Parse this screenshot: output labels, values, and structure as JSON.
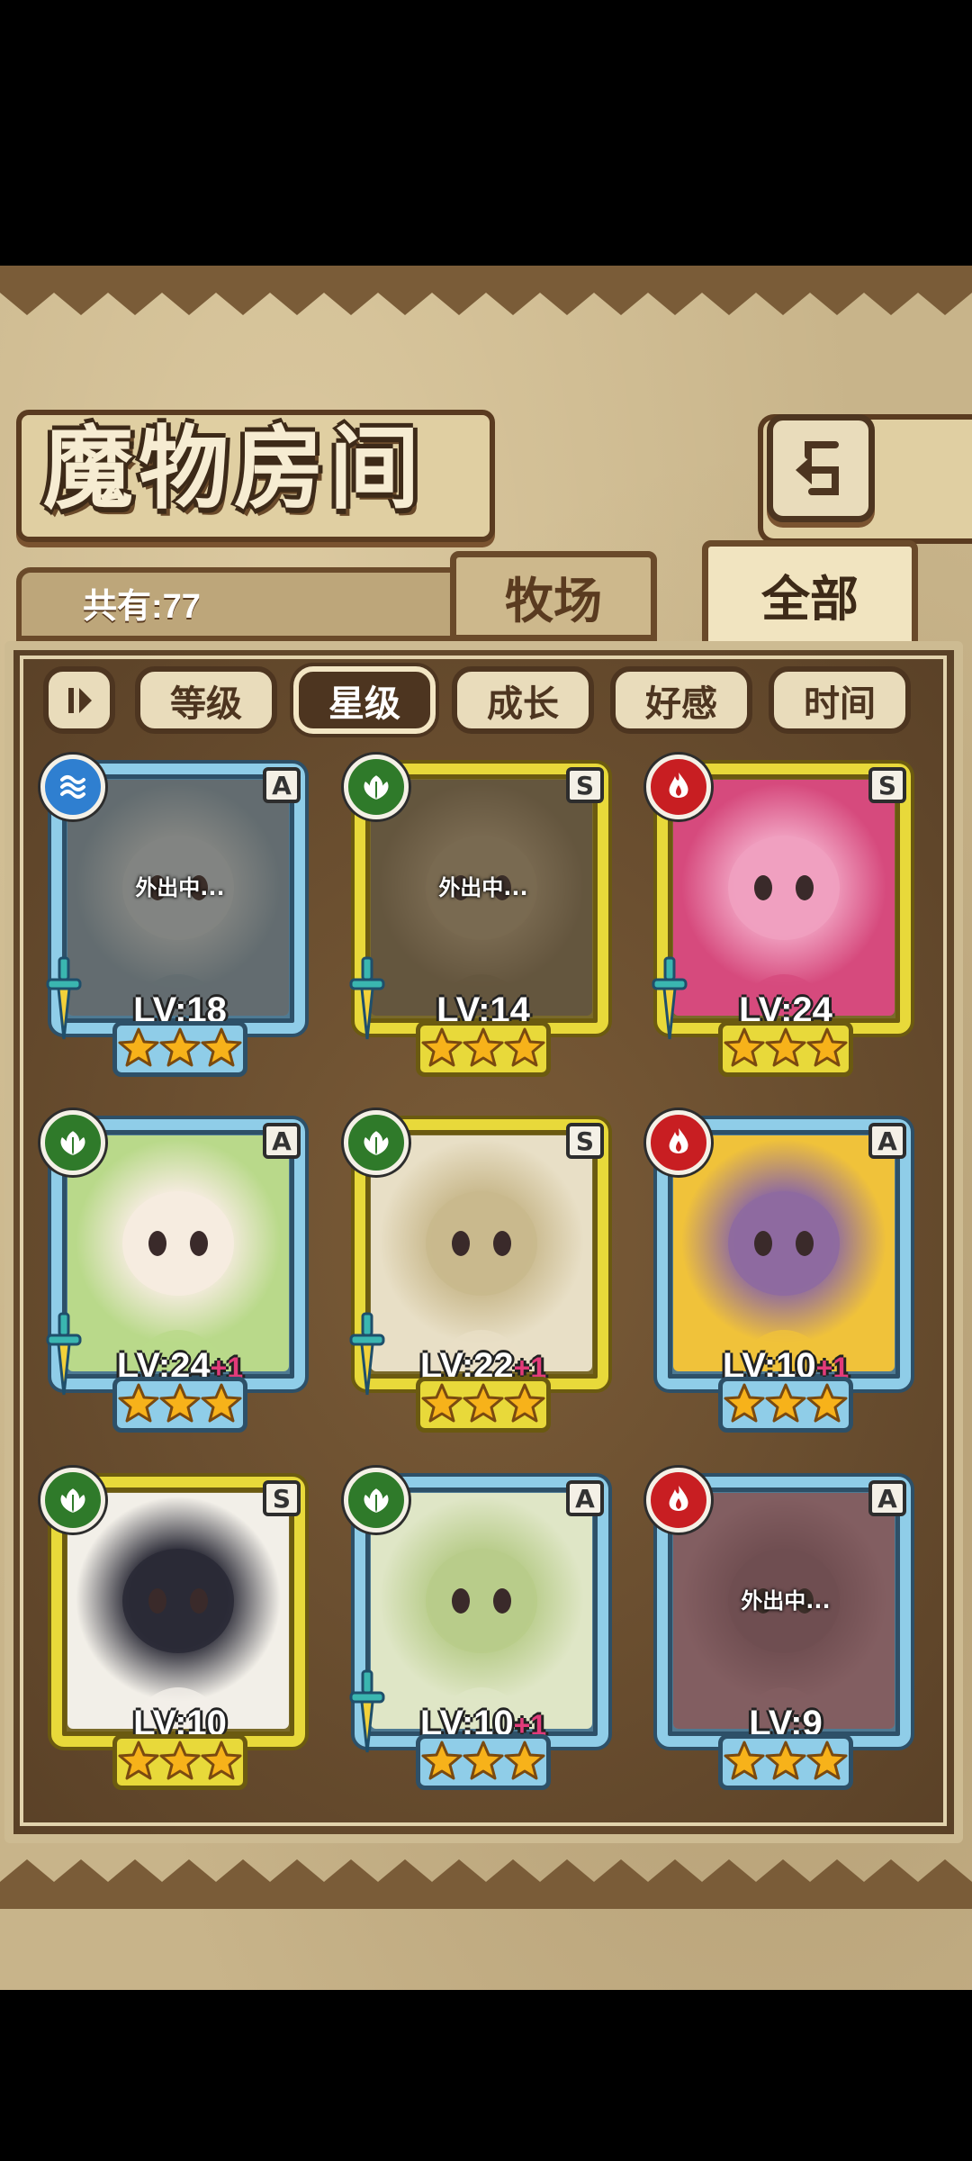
{
  "screen": {
    "title": "魔物房间",
    "count_label": "共有:77",
    "tabs": [
      {
        "label": "牧场",
        "active": false
      },
      {
        "label": "全部",
        "active": true
      }
    ],
    "sort": {
      "buttons": [
        {
          "label": "等级",
          "active": false
        },
        {
          "label": "星级",
          "active": true
        },
        {
          "label": "成长",
          "active": false
        },
        {
          "label": "好感",
          "active": false
        },
        {
          "label": "时间",
          "active": false
        }
      ]
    }
  },
  "monsters": [
    {
      "level": "LV:18",
      "plus": "",
      "rank": "A",
      "element": "water",
      "stars": 3,
      "status": "外出中...",
      "equipped": true,
      "palette": [
        "#8aa7b8",
        "#c9d7db"
      ]
    },
    {
      "level": "LV:14",
      "plus": "",
      "rank": "S",
      "element": "wood",
      "stars": 3,
      "status": "外出中...",
      "equipped": true,
      "palette": [
        "#8d7a55",
        "#b7a27a"
      ]
    },
    {
      "level": "LV:24",
      "plus": "",
      "rank": "S",
      "element": "fire",
      "stars": 3,
      "status": "",
      "equipped": true,
      "palette": [
        "#d64a7d",
        "#f0a0c0"
      ]
    },
    {
      "level": "LV:24",
      "plus": "+1",
      "rank": "A",
      "element": "wood",
      "stars": 3,
      "status": "",
      "equipped": true,
      "palette": [
        "#b9d98a",
        "#f6ece0"
      ]
    },
    {
      "level": "LV:22",
      "plus": "+1",
      "rank": "S",
      "element": "wood",
      "stars": 3,
      "status": "",
      "equipped": true,
      "palette": [
        "#e8dfc6",
        "#c9b98d"
      ]
    },
    {
      "level": "LV:10",
      "plus": "+1",
      "rank": "A",
      "element": "fire",
      "stars": 3,
      "status": "",
      "equipped": false,
      "palette": [
        "#f0c23a",
        "#8e6aa0"
      ]
    },
    {
      "level": "LV:10",
      "plus": "",
      "rank": "S",
      "element": "wood",
      "stars": 3,
      "status": "",
      "equipped": false,
      "palette": [
        "#f2efe8",
        "#2a2a36"
      ]
    },
    {
      "level": "LV:10",
      "plus": "+1",
      "rank": "A",
      "element": "wood",
      "stars": 3,
      "status": "",
      "equipped": true,
      "palette": [
        "#dfe6c6",
        "#b8cc8a"
      ]
    },
    {
      "level": "LV:9",
      "plus": "",
      "rank": "A",
      "element": "fire",
      "stars": 3,
      "status": "外出中...",
      "equipped": false,
      "palette": [
        "#c98a9a",
        "#a36a7a"
      ]
    }
  ],
  "colors": {
    "accent_dark": "#4d3520",
    "parchment": "#e9dcbb",
    "rank_A": "#8fcde8",
    "rank_S": "#e8d93a",
    "star": "#f7b21a",
    "plus_level": "#e23b7a"
  },
  "icons": {
    "back": "back-arrow-icon",
    "sort_toggle": "sort-order-icon",
    "water": "water-element-icon",
    "wood": "leaf-element-icon",
    "fire": "fire-element-icon",
    "weapon": "sword-icon",
    "star": "star-icon"
  }
}
